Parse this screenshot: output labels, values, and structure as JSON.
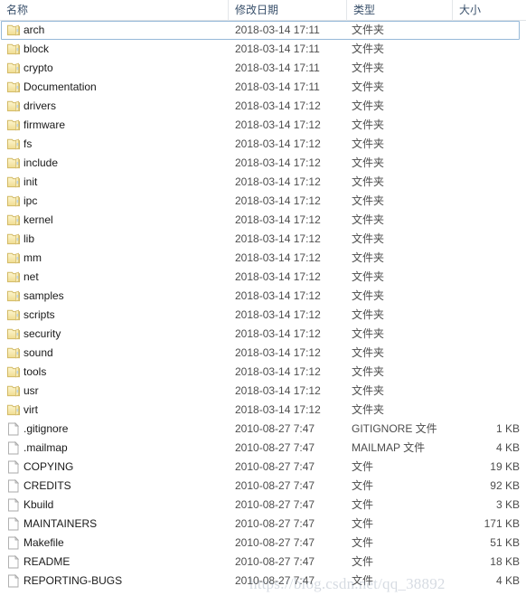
{
  "columns": {
    "name": "名称",
    "date": "修改日期",
    "type": "类型",
    "size": "大小"
  },
  "types": {
    "folder": "文件夹",
    "file": "文件",
    "gitignore": "GITIGNORE 文件",
    "mailmap": "MAILMAP 文件"
  },
  "icons": {
    "folder": "folder-icon",
    "file": "file-icon"
  },
  "watermark": "https://blog.csdn.net/qq_38892",
  "rows": [
    {
      "name": "arch",
      "date": "2018-03-14 17:11",
      "type": "文件夹",
      "size": "",
      "kind": "folder",
      "selected": true
    },
    {
      "name": "block",
      "date": "2018-03-14 17:11",
      "type": "文件夹",
      "size": "",
      "kind": "folder",
      "selected": false
    },
    {
      "name": "crypto",
      "date": "2018-03-14 17:11",
      "type": "文件夹",
      "size": "",
      "kind": "folder",
      "selected": false
    },
    {
      "name": "Documentation",
      "date": "2018-03-14 17:11",
      "type": "文件夹",
      "size": "",
      "kind": "folder",
      "selected": false
    },
    {
      "name": "drivers",
      "date": "2018-03-14 17:12",
      "type": "文件夹",
      "size": "",
      "kind": "folder",
      "selected": false
    },
    {
      "name": "firmware",
      "date": "2018-03-14 17:12",
      "type": "文件夹",
      "size": "",
      "kind": "folder",
      "selected": false
    },
    {
      "name": "fs",
      "date": "2018-03-14 17:12",
      "type": "文件夹",
      "size": "",
      "kind": "folder",
      "selected": false
    },
    {
      "name": "include",
      "date": "2018-03-14 17:12",
      "type": "文件夹",
      "size": "",
      "kind": "folder",
      "selected": false
    },
    {
      "name": "init",
      "date": "2018-03-14 17:12",
      "type": "文件夹",
      "size": "",
      "kind": "folder",
      "selected": false
    },
    {
      "name": "ipc",
      "date": "2018-03-14 17:12",
      "type": "文件夹",
      "size": "",
      "kind": "folder",
      "selected": false
    },
    {
      "name": "kernel",
      "date": "2018-03-14 17:12",
      "type": "文件夹",
      "size": "",
      "kind": "folder",
      "selected": false
    },
    {
      "name": "lib",
      "date": "2018-03-14 17:12",
      "type": "文件夹",
      "size": "",
      "kind": "folder",
      "selected": false
    },
    {
      "name": "mm",
      "date": "2018-03-14 17:12",
      "type": "文件夹",
      "size": "",
      "kind": "folder",
      "selected": false
    },
    {
      "name": "net",
      "date": "2018-03-14 17:12",
      "type": "文件夹",
      "size": "",
      "kind": "folder",
      "selected": false
    },
    {
      "name": "samples",
      "date": "2018-03-14 17:12",
      "type": "文件夹",
      "size": "",
      "kind": "folder",
      "selected": false
    },
    {
      "name": "scripts",
      "date": "2018-03-14 17:12",
      "type": "文件夹",
      "size": "",
      "kind": "folder",
      "selected": false
    },
    {
      "name": "security",
      "date": "2018-03-14 17:12",
      "type": "文件夹",
      "size": "",
      "kind": "folder",
      "selected": false
    },
    {
      "name": "sound",
      "date": "2018-03-14 17:12",
      "type": "文件夹",
      "size": "",
      "kind": "folder",
      "selected": false
    },
    {
      "name": "tools",
      "date": "2018-03-14 17:12",
      "type": "文件夹",
      "size": "",
      "kind": "folder",
      "selected": false
    },
    {
      "name": "usr",
      "date": "2018-03-14 17:12",
      "type": "文件夹",
      "size": "",
      "kind": "folder",
      "selected": false
    },
    {
      "name": "virt",
      "date": "2018-03-14 17:12",
      "type": "文件夹",
      "size": "",
      "kind": "folder",
      "selected": false
    },
    {
      "name": ".gitignore",
      "date": "2010-08-27 7:47",
      "type": "GITIGNORE 文件",
      "size": "1 KB",
      "kind": "file",
      "selected": false
    },
    {
      "name": ".mailmap",
      "date": "2010-08-27 7:47",
      "type": "MAILMAP 文件",
      "size": "4 KB",
      "kind": "file",
      "selected": false
    },
    {
      "name": "COPYING",
      "date": "2010-08-27 7:47",
      "type": "文件",
      "size": "19 KB",
      "kind": "file",
      "selected": false
    },
    {
      "name": "CREDITS",
      "date": "2010-08-27 7:47",
      "type": "文件",
      "size": "92 KB",
      "kind": "file",
      "selected": false
    },
    {
      "name": "Kbuild",
      "date": "2010-08-27 7:47",
      "type": "文件",
      "size": "3 KB",
      "kind": "file",
      "selected": false
    },
    {
      "name": "MAINTAINERS",
      "date": "2010-08-27 7:47",
      "type": "文件",
      "size": "171 KB",
      "kind": "file",
      "selected": false
    },
    {
      "name": "Makefile",
      "date": "2010-08-27 7:47",
      "type": "文件",
      "size": "51 KB",
      "kind": "file",
      "selected": false
    },
    {
      "name": "README",
      "date": "2010-08-27 7:47",
      "type": "文件",
      "size": "18 KB",
      "kind": "file",
      "selected": false
    },
    {
      "name": "REPORTING-BUGS",
      "date": "2010-08-27 7:47",
      "type": "文件",
      "size": "4 KB",
      "kind": "file",
      "selected": false
    }
  ],
  "colors": {
    "folder_fill": "#f5e7a8",
    "folder_edge": "#d9c06a",
    "file_fill": "#ffffff",
    "file_edge": "#a8a8a8",
    "selection_border": "#96b9d8",
    "header_text": "#39506b"
  }
}
